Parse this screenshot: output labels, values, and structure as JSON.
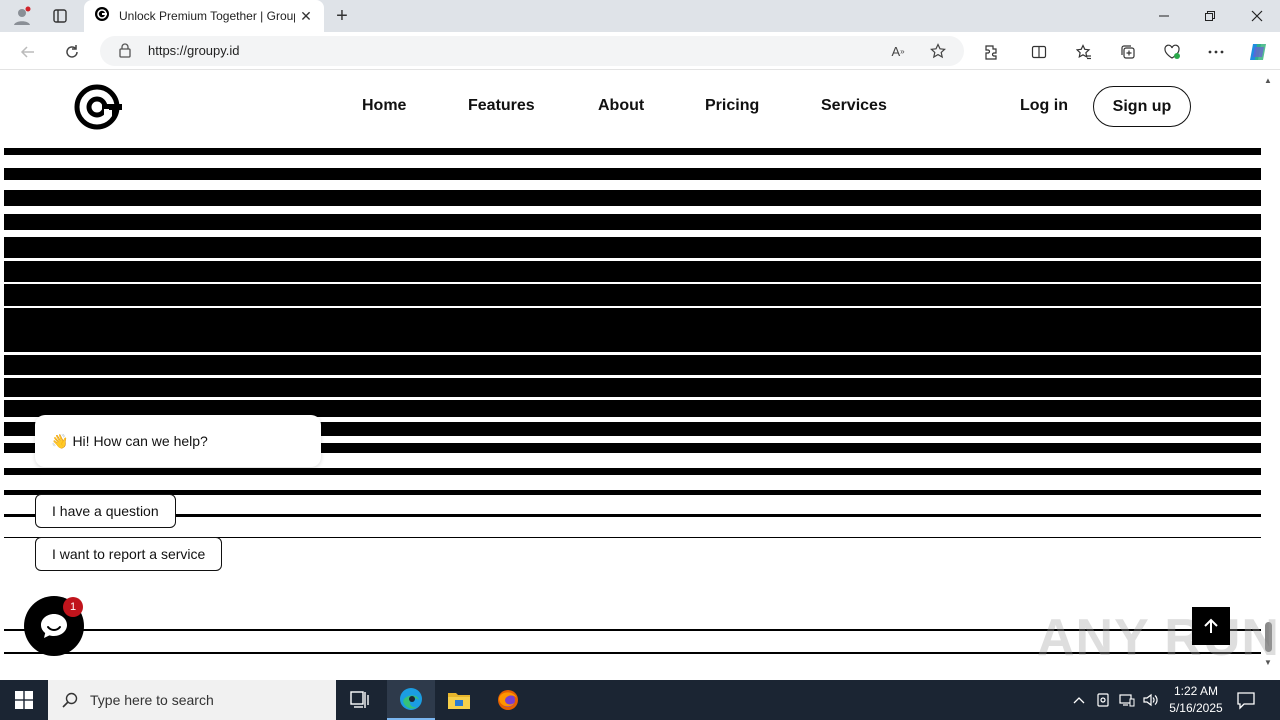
{
  "browser": {
    "tab_title": "Unlock Premium Together | Groupy",
    "url": "https://groupy.id",
    "window_controls": [
      "minimize",
      "restore",
      "close"
    ]
  },
  "site": {
    "nav": [
      "Home",
      "Features",
      "About",
      "Pricing",
      "Services"
    ],
    "login": "Log in",
    "signup": "Sign up"
  },
  "chat": {
    "greeting": "Hi! How can we help?",
    "greeting_emoji": "👋",
    "options": [
      "I have a question",
      "I want to report a service"
    ],
    "badge_count": "1"
  },
  "watermark": "ANY RUN",
  "taskbar": {
    "search_placeholder": "Type here to search",
    "time": "1:22 AM",
    "date": "5/16/2025"
  },
  "colors": {
    "accent": "#000000",
    "badge": "#c0141c",
    "taskbar": "#1b2533"
  }
}
